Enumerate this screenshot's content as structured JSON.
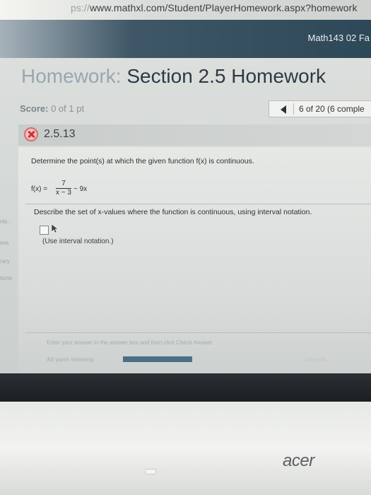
{
  "browser": {
    "url_faint": "ps://",
    "url_main": "www.mathxl.com/Student/PlayerHomework.aspx?homework"
  },
  "header": {
    "course": "Math143 02 Fa"
  },
  "homework": {
    "title_faint": "Homework:",
    "title": " Section 2.5 Homework",
    "score_label": "Score:",
    "score_value": " 0 of 1 pt",
    "question_position": "6 of 20 (6 comple"
  },
  "question": {
    "number": "2.5.13",
    "status": "incorrect",
    "prompt": "Determine the point(s) at which the given function f(x) is continuous.",
    "function": {
      "lhs": "f(x) =",
      "numerator": "7",
      "denominator": "x − 3",
      "rhs": "− 9x"
    },
    "instruction": "Describe the set of x-values where the function is continuous, using interval notation.",
    "answer_hint": "(Use interval notation.)",
    "enter_message": "Enter your answer in the answer box and then click Check Answer.",
    "parts_label": "All parts showing",
    "progress_fraction": 1.0,
    "clear_all": "Clear All"
  },
  "sidebar": {
    "items": [
      "nts :",
      "ess",
      "rary",
      "tions"
    ]
  },
  "device": {
    "brand": "acer"
  },
  "colors": {
    "nav_dark": "#2d4858",
    "progress_fill": "#4c6f88",
    "incorrect_red": "#cc3333"
  }
}
